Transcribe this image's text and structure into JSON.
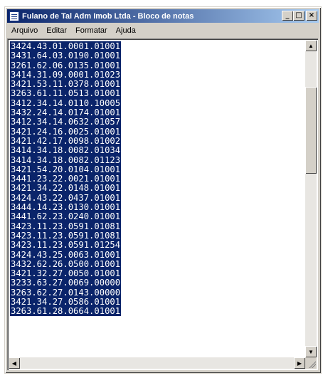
{
  "window": {
    "title": "Fulano de Tal Adm Imob Ltda - Bloco de notas",
    "minimize_glyph": "_",
    "maximize_glyph": "□",
    "close_glyph": "×"
  },
  "menu": [
    "Arquivo",
    "Editar",
    "Formatar",
    "Ajuda"
  ],
  "document": {
    "lines": [
      "3424.43.01.0001.01001",
      "3431.64.03.0190.01001",
      "3261.62.06.0135.01001",
      "3414.31.09.0001.01023",
      "3421.53.11.0378.01001",
      "3263.61.11.0513.01001",
      "3412.34.14.0110.10005",
      "3432.24.14.0174.01001",
      "3412.34.14.0632.01057",
      "3421.24.16.0025.01001",
      "3421.42.17.0098.01002",
      "3414.34.18.0082.01034",
      "3414.34.18.0082.01123",
      "3421.54.20.0104.01001",
      "3441.23.22.0021.01001",
      "3421.34.22.0148.01001",
      "3424.43.22.0437.01001",
      "3444.14.23.0130.01001",
      "3441.62.23.0240.01001",
      "3423.11.23.0591.01081",
      "3423.11.23.0591.01081",
      "3423.11.23.0591.01254",
      "3424.43.25.0063.01001",
      "3432.62.26.0500.01001",
      "3421.32.27.0050.01001",
      "3233.63.27.0069.00000",
      "3263.62.27.0143.00000",
      "3421.34.27.0586.01001",
      "3263.61.28.0664.01001"
    ]
  },
  "scrollbar": {
    "up_arrow": "▲",
    "down_arrow": "▼",
    "left_arrow": "◀",
    "right_arrow": "▶"
  }
}
